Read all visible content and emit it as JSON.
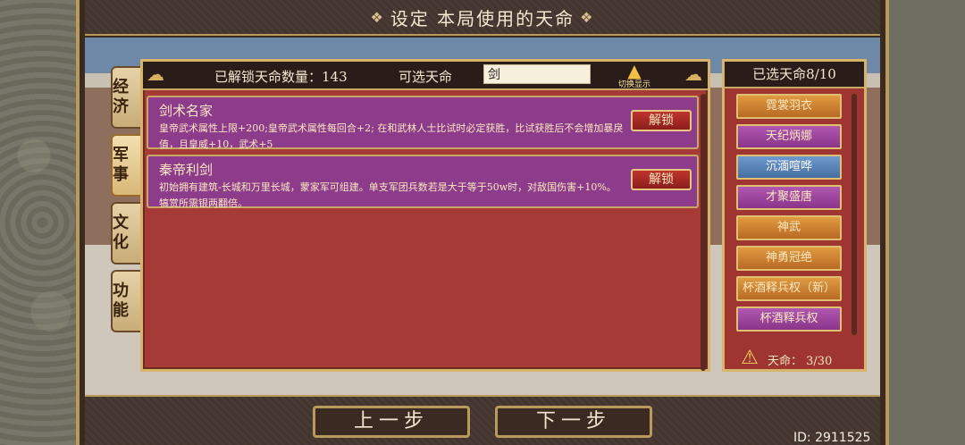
{
  "title": "设定 本局使用的天命",
  "tabs": [
    {
      "label": "经济"
    },
    {
      "label": "军事"
    },
    {
      "label": "文化"
    },
    {
      "label": "功能"
    }
  ],
  "list": {
    "unlocked_label": "已解锁天命数量：143",
    "available_label": "可选天命",
    "search_value": "剑",
    "clear_label": "切换显示",
    "entries": [
      {
        "name": "剑术名家",
        "desc": "皇帝武术属性上限+200;皇帝武术属性每回合+2; 在和武林人士比试时必定获胜，比试获胜后不会增加暴戾值，且皇威+10，武术+5",
        "button": "解锁"
      },
      {
        "name": "秦帝利剑",
        "desc": "初始拥有建筑-长城和万里长城，蒙家军可组建。单支军团兵数若是大于等于50w时，对敌国伤害+10%。犒赏所需银两翻倍。",
        "button": "解锁"
      }
    ]
  },
  "selected": {
    "header": "已选天命8/10",
    "items": [
      {
        "label": "霓裳羽衣",
        "color": "orange"
      },
      {
        "label": "天纪炳娜",
        "color": "purple"
      },
      {
        "label": "沉湎喧哗",
        "color": "blue"
      },
      {
        "label": "才聚盛唐",
        "color": "purple"
      },
      {
        "label": "神武",
        "color": "orange"
      },
      {
        "label": "神勇冠绝",
        "color": "orange"
      },
      {
        "label": "杯酒释兵权（新）",
        "color": "orange"
      },
      {
        "label": "杯酒释兵权",
        "color": "purple"
      }
    ],
    "count_label": "天命： 3/30"
  },
  "nav": {
    "prev": "上一步",
    "next": "下一步"
  },
  "user_id": "ID: 2911525"
}
